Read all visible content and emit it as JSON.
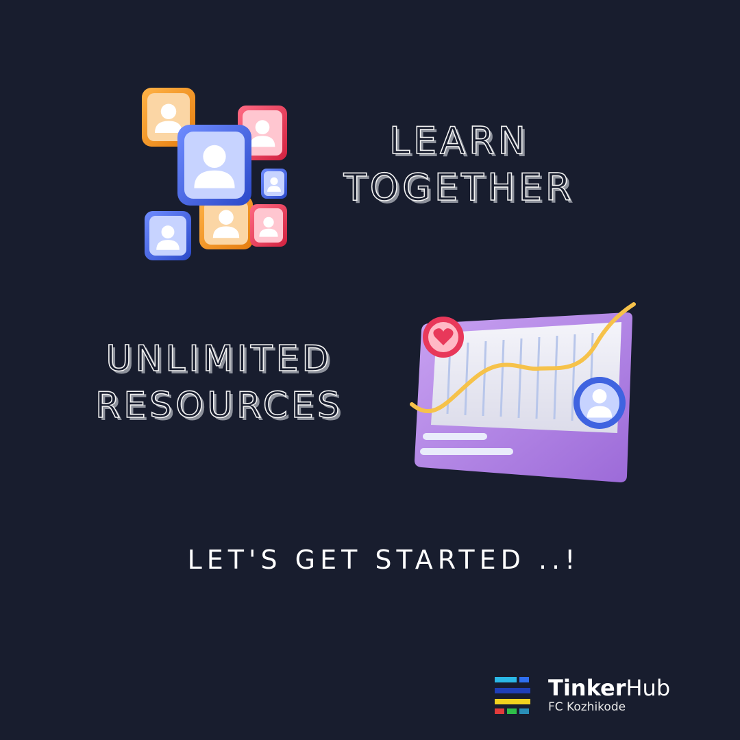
{
  "headline_learn": {
    "line1": "LEARN",
    "line2": "TOGETHER"
  },
  "headline_resources": {
    "line1": "UNLIMITED",
    "line2": "RESOURCES"
  },
  "call_to_action": "LET'S GET STARTED ..!",
  "logo": {
    "name_bold": "Tinker",
    "name_regular": "Hub",
    "subtitle": "FC Kozhikode"
  },
  "colors": {
    "background": "#181d2e",
    "orange": "#f39a1e",
    "blue": "#3f63e0",
    "red": "#e8385a",
    "purple": "#b98ae6",
    "curve": "#f6c24a"
  },
  "icons": [
    "user-profile-icon",
    "heart-icon",
    "analytics-chart-icon"
  ]
}
